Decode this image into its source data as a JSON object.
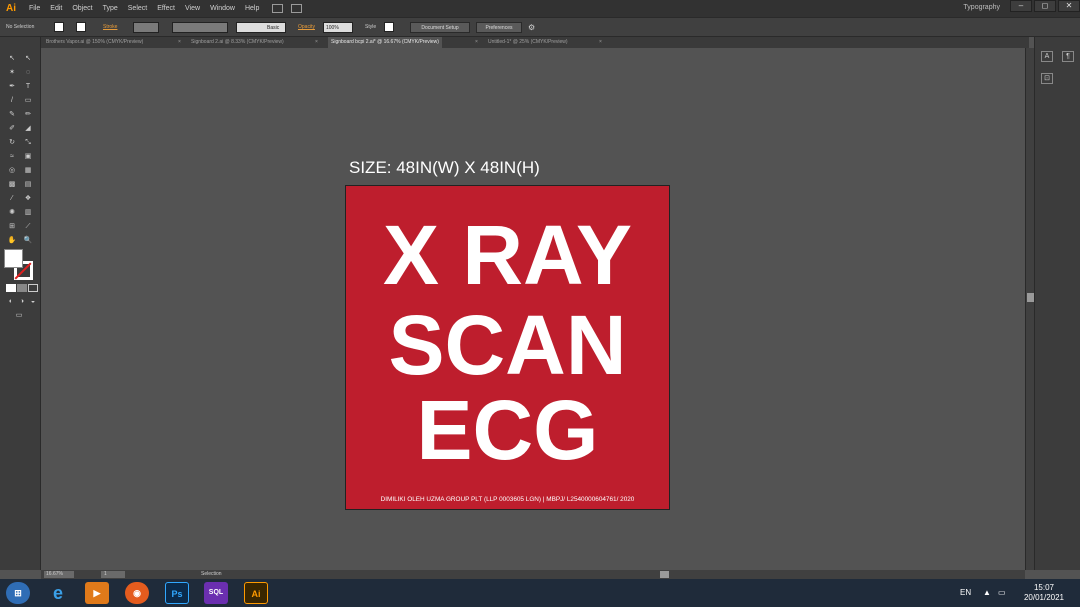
{
  "app": {
    "logo": "Ai",
    "menu": [
      "File",
      "Edit",
      "Object",
      "Type",
      "Select",
      "Effect",
      "View",
      "Window",
      "Help"
    ],
    "workspace": "Typography",
    "window_buttons": [
      "–",
      "◻",
      "✕"
    ]
  },
  "controlbar": {
    "selection": "No Selection",
    "stroke_label": "Stroke",
    "stroke_style": "Basic",
    "opacity_label": "Opacity",
    "opacity_value": "100%",
    "style_label": "Style",
    "doc_setup": "Document Setup",
    "preferences": "Preferences"
  },
  "tabs": [
    "Brothers Vapor.ai @ 150% (CMYK/Preview)",
    "Signboard 2.ai @ 8.33% (CMYK/Preview)",
    "Signboard bcpi 2.ai* @ 16.67% (CMYK/Preview)",
    "Untitled-1* @ 25% (CMYK/Preview)"
  ],
  "canvas": {
    "size_label": "SIZE: 48IN(W) X 48IN(H)",
    "sign_line1": "X RAY",
    "sign_line2": "SCAN",
    "sign_line3": "ECG",
    "sign_footer": "DIMILIKI OLEH UZMA GROUP PLT (LLP 0003605 LGN) | MBPJ/ L2540000604761/ 2020",
    "sign_color": "#be1e2d"
  },
  "status": {
    "zoom": "16.67%",
    "page": "1",
    "tool": "Selection"
  },
  "taskbar": {
    "apps": [
      "start",
      "internet-explorer",
      "media-player",
      "firefox",
      "photoshop",
      "sql-app",
      "illustrator"
    ],
    "ps_label": "Ps",
    "ai_label": "Ai",
    "sql_label": "SQL",
    "lang": "EN",
    "time": "15:07",
    "date": "20/01/2021"
  }
}
